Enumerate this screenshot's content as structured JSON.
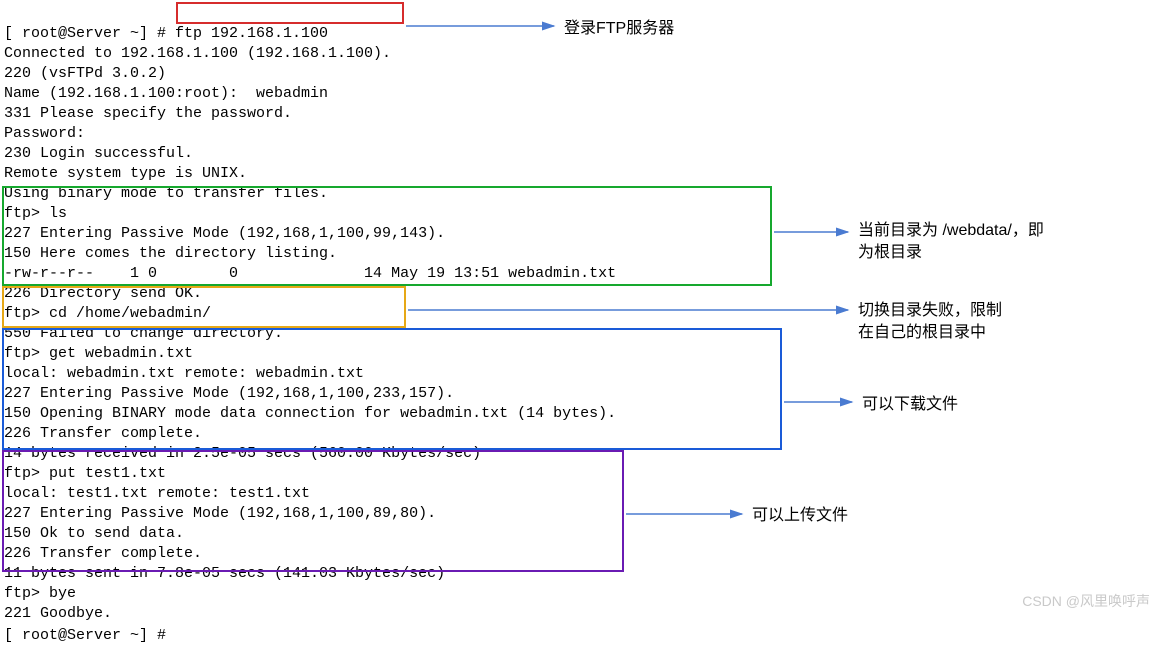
{
  "terminal": {
    "line1_prompt": "[ root@Server ~] # ",
    "line1_cmd": "ftp 192.168.1.100",
    "line2": "Connected to 192.168.1.100 (192.168.1.100).",
    "line3": "220 (vsFTPd 3.0.2)",
    "line4": "Name (192.168.1.100:root):  webadmin",
    "line5": "331 Please specify the password.",
    "line6": "Password:",
    "line7": "230 Login successful.",
    "line8": "Remote system type is UNIX.",
    "line9": "Using binary mode to transfer files.",
    "line10": "ftp> ls",
    "line11": "227 Entering Passive Mode (192,168,1,100,99,143).",
    "line12": "150 Here comes the directory listing.",
    "line13": "-rw-r--r--    1 0        0              14 May 19 13:51 webadmin.txt",
    "line14": "226 Directory send OK.",
    "line15": "ftp> cd /home/webadmin/",
    "line16": "550 Failed to change directory.",
    "line17": "ftp> get webadmin.txt",
    "line18": "local: webadmin.txt remote: webadmin.txt",
    "line19": "227 Entering Passive Mode (192,168,1,100,233,157).",
    "line20": "150 Opening BINARY mode data connection for webadmin.txt (14 bytes).",
    "line21": "226 Transfer complete.",
    "line22": "14 bytes received in 2.5e-05 secs (560.00 Kbytes/sec)",
    "line23": "ftp> put test1.txt",
    "line24": "local: test1.txt remote: test1.txt",
    "line25": "227 Entering Passive Mode (192,168,1,100,89,80).",
    "line26": "150 Ok to send data.",
    "line27": "226 Transfer complete.",
    "line28": "11 bytes sent in 7.8e-05 secs (141.03 Kbytes/sec)",
    "line29": "ftp> bye",
    "line30": "221 Goodbye.",
    "line31": "[ root@Server ~] # "
  },
  "annotations": {
    "a1": "登录FTP服务器",
    "a2_l1": "当前目录为 /webdata/，即",
    "a2_l2": "为根目录",
    "a3_l1": "切换目录失败，限制",
    "a3_l2": "在自己的根目录中",
    "a4": "可以下载文件",
    "a5": "可以上传文件"
  },
  "watermark": "CSDN @风里唤呼声",
  "colors": {
    "red": "#d62c2c",
    "green": "#16a82e",
    "orange": "#e6a817",
    "blue": "#1a5bd8",
    "purple": "#6a1bb3",
    "arrow": "#4a7bd1"
  }
}
